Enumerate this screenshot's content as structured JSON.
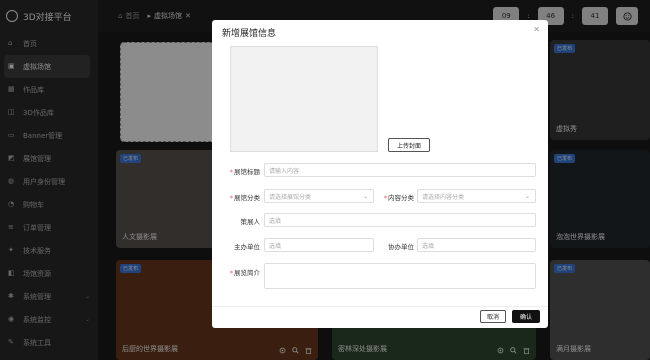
{
  "app": {
    "title": "3D对接平台"
  },
  "sidebar": {
    "items": [
      {
        "label": "首页",
        "icon": "home-icon"
      },
      {
        "label": "虚拟场馆",
        "icon": "cube-icon",
        "active": true
      },
      {
        "label": "作品库",
        "icon": "image-icon"
      },
      {
        "label": "3D作品库",
        "icon": "box-icon"
      },
      {
        "label": "Banner管理",
        "icon": "banner-icon"
      },
      {
        "label": "展馆管理",
        "icon": "gallery-icon"
      },
      {
        "label": "用户身份管理",
        "icon": "user-icon"
      },
      {
        "label": "购物车",
        "icon": "cart-icon"
      },
      {
        "label": "订单管理",
        "icon": "order-icon"
      },
      {
        "label": "技术服务",
        "icon": "service-icon"
      },
      {
        "label": "场馆资源",
        "icon": "resource-icon"
      },
      {
        "label": "系统管理",
        "icon": "gear-icon",
        "expandable": true
      },
      {
        "label": "系统监控",
        "icon": "monitor-icon",
        "expandable": true
      },
      {
        "label": "系统工具",
        "icon": "tool-icon"
      }
    ]
  },
  "header": {
    "tabs": [
      {
        "label": "首页"
      },
      {
        "label": "虚拟场馆",
        "current": true
      }
    ],
    "clock": {
      "h": "09",
      "m": "46",
      "s": "41"
    }
  },
  "cards": [
    {
      "title": "虚拟秀",
      "badge": "已发布"
    },
    {
      "title": "人文摄影展",
      "badge": "已发布"
    },
    {
      "title": "泡泡世界摄影展",
      "badge": "已发布"
    },
    {
      "title": "后厨的世界摄影展",
      "badge": "已发布"
    },
    {
      "title": "密林深处摄影展",
      "badge": ""
    },
    {
      "title": "满月摄影展",
      "badge": "已发布"
    }
  ],
  "modal": {
    "title": "新增展馆信息",
    "upload_label": "上传封面",
    "fields": {
      "name_label": "展馆标题",
      "name_placeholder": "请输入内容",
      "category_label": "展馆分类",
      "category_placeholder": "请选择展馆分类",
      "content_label": "内容分类",
      "content_placeholder": "请选择内容分类",
      "curator_label": "策展人",
      "curator_placeholder": "选填",
      "host_label": "主办单位",
      "host_placeholder": "选填",
      "co_label": "协办单位",
      "co_placeholder": "选填",
      "intro_label": "展览简介"
    },
    "cancel_label": "取消",
    "ok_label": "确认"
  },
  "colors": {
    "accent": "#3d7be0",
    "sidebar_bg": "#2b2b2b",
    "primary_btn": "#111111"
  }
}
